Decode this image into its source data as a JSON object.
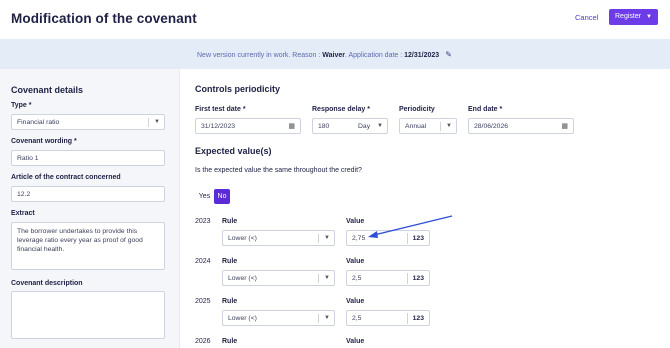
{
  "header": {
    "title": "Modification of the covenant",
    "cancel_label": "Cancel",
    "register_label": "Register"
  },
  "banner": {
    "prefix": "New version currently in work. Reason : ",
    "reason": "Waiver",
    "date_prefix": ". Application date : ",
    "date": "12/31/2023"
  },
  "left": {
    "title": "Covenant details",
    "type_label": "Type *",
    "type_value": "Financial ratio",
    "wording_label": "Covenant wording *",
    "wording_value": "Ratio 1",
    "article_label": "Article of the contract concerned",
    "article_value": "12.2",
    "extract_label": "Extract",
    "extract_value": "The borrower undertakes to provide this leverage ratio every year as proof of good financial health.",
    "description_label": "Covenant description",
    "description_value": ""
  },
  "periodicity": {
    "title": "Controls periodicity",
    "first_test_label": "First test date *",
    "first_test_value": "31/12/2023",
    "delay_label": "Response delay *",
    "delay_value": "180",
    "delay_unit": "Day",
    "periodicity_label": "Periodicity",
    "periodicity_value": "Annual",
    "end_label": "End date *",
    "end_value": "28/06/2026"
  },
  "expected": {
    "title": "Expected value(s)",
    "question": "Is the expected value the same throughout the credit?",
    "yes_label": "Yes",
    "no_label": "No",
    "rule_label": "Rule",
    "value_label": "Value",
    "unit_label": "123",
    "rows": [
      {
        "year": "2023",
        "rule": "Lower (<)",
        "value": "2,75"
      },
      {
        "year": "2024",
        "rule": "Lower (<)",
        "value": "2,5"
      },
      {
        "year": "2025",
        "rule": "Lower (<)",
        "value": "2,5"
      },
      {
        "year": "2026",
        "rule": "",
        "value": ""
      }
    ]
  },
  "colors": {
    "accent": "#6d3ce8",
    "banner_bg": "#e3ecf7",
    "left_bg": "#f4f6fa",
    "arrow": "#2f4fd8"
  },
  "icons": {
    "chevron": "chevron-down-icon",
    "calendar": "calendar-icon",
    "edit": "pencil-icon"
  }
}
